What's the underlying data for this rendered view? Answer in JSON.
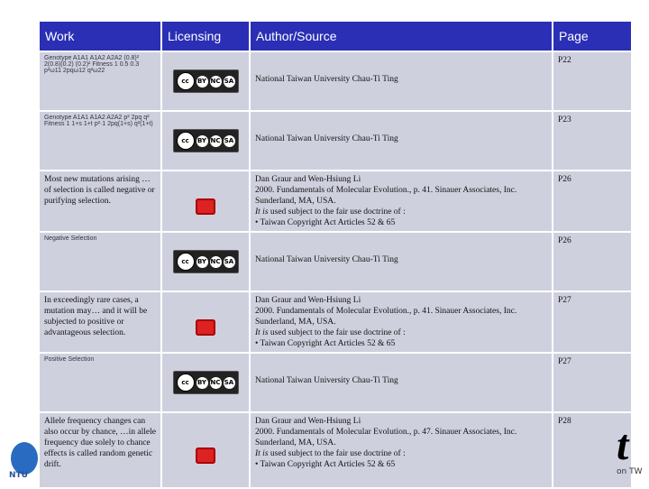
{
  "header": {
    "work": "Work",
    "licensing": "Licensing",
    "author": "Author/Source",
    "page": "Page"
  },
  "rows": [
    {
      "work": "",
      "work_image": "genotype-fitness-table",
      "license": "cc-by-nc-sa",
      "author_lines": [
        "National Taiwan University Chau-Ti Ting"
      ],
      "page": "P22",
      "image_text": [
        "Genotype",
        "A1A1",
        "A1A2",
        "A2A2",
        "(0.8)²",
        "2(0.8)(0.2)",
        "(0.2)²",
        "Fitness",
        "1",
        "0.5",
        "0.3",
        "p²ω11",
        "2pqω12",
        "q²ω22"
      ]
    },
    {
      "work": "",
      "work_image": "genotype-fitness-table",
      "license": "cc-by-nc-sa",
      "author_lines": [
        "National Taiwan University Chau-Ti Ting"
      ],
      "page": "P23",
      "image_text": [
        "Genotype",
        "A1A1",
        "A1A2",
        "A2A2",
        "p²",
        "2pq",
        "q²",
        "Fitness",
        "1",
        "1+s",
        "1+t",
        "p²·1",
        "2pq(1+s)",
        "q²(1+t)"
      ]
    },
    {
      "work": "Most new mutations arising …of selection is called negative or purifying selection.",
      "license": "fair-use",
      "author_lines": [
        "Dan Graur and Wen-Hsiung Li",
        "2000. Fundamentals of Molecular Evolution., p. 41. Sinauer Associates, Inc.",
        "Sunderland, MA, USA."
      ],
      "fair_use_italic": "It is",
      "fair_use_rest": " used subject to the fair use doctrine of :",
      "article": "• Taiwan Copyright Act Articles 52 & 65",
      "page": "P26"
    },
    {
      "work": "",
      "work_image": "negative-selection-diagram",
      "image_text": [
        "Negative Selection"
      ],
      "license": "cc-by-nc-sa",
      "author_lines": [
        "National Taiwan University Chau-Ti Ting"
      ],
      "page": "P26"
    },
    {
      "work": "In exceedingly rare cases, a mutation may… and it will be subjected to positive or advantageous selection.",
      "license": "fair-use",
      "author_lines": [
        "Dan Graur and Wen-Hsiung Li",
        "2000. Fundamentals of Molecular Evolution., p. 41. Sinauer Associates, Inc.",
        "Sunderland, MA, USA."
      ],
      "fair_use_italic": "It is",
      "fair_use_rest": " used subject to the fair use doctrine of :",
      "article": "• Taiwan Copyright Act Articles 52 & 65",
      "page": "P27"
    },
    {
      "work": "",
      "work_image": "positive-selection-diagram",
      "image_text": [
        "Positive Selection"
      ],
      "license": "cc-by-nc-sa",
      "author_lines": [
        "National Taiwan University Chau-Ti Ting"
      ],
      "page": "P27"
    },
    {
      "work": "Allele frequency changes can also occur by chance, …in allele frequency due solely to chance effects is called random genetic drift.",
      "license": "fair-use",
      "author_lines": [
        "Dan Graur and Wen-Hsiung Li",
        "2000. Fundamentals of Molecular Evolution., p. 47. Sinauer Associates, Inc.",
        "Sunderland, MA, USA."
      ],
      "fair_use_italic": "It is",
      "fair_use_rest": " used subject to the fair use doctrine of :",
      "article": "• Taiwan Copyright Act Articles 52 & 65",
      "page": "P28"
    }
  ],
  "cc_badge": {
    "cc": "cc",
    "labels": [
      "BY",
      "NC",
      "SA"
    ]
  },
  "logos": {
    "ntu": "NTU",
    "ocw": "t",
    "ocw_sub": "on TW"
  },
  "colors": {
    "header": "#2a2fb5",
    "cell": "#cfd0de"
  }
}
